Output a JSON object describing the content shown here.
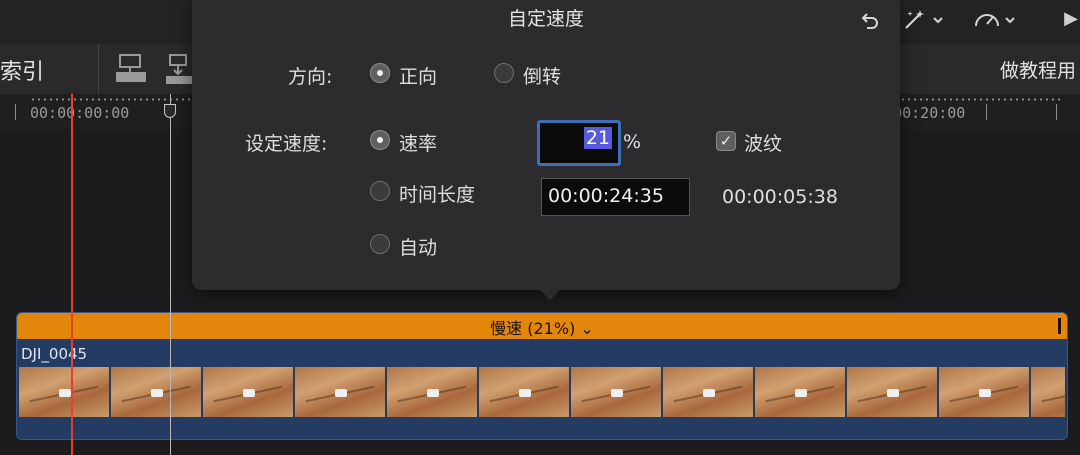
{
  "toolbar": {
    "index_label": "索引",
    "project_title": "做教程用"
  },
  "ruler": {
    "left_timecode": "00:00:00:00",
    "right_timecode": "00:00:20:00"
  },
  "popup": {
    "title": "自定速度",
    "direction_label": "方向:",
    "forward": "正向",
    "reverse": "倒转",
    "set_speed_label": "设定速度:",
    "rate": "速率",
    "duration": "时间长度",
    "auto": "自动",
    "rate_value": "21",
    "percent": "%",
    "ripple": "波纹",
    "duration_value": "00:00:24:35",
    "new_duration": "00:00:05:38"
  },
  "clip": {
    "speed_label": "慢速 (21%) ⌄",
    "name": "DJI_0045"
  },
  "icons": {
    "undo": "undo-icon",
    "magic": "magic-wand-icon",
    "speed": "speedometer-icon",
    "play": "play-icon"
  }
}
